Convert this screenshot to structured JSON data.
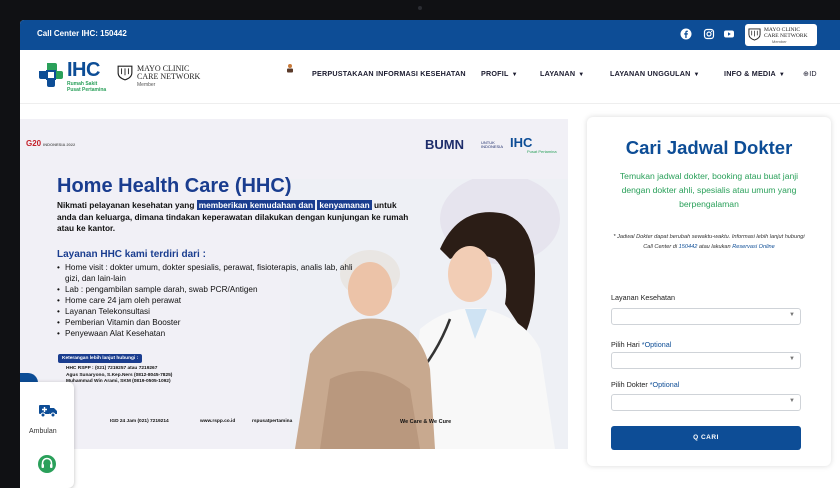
{
  "topbar": {
    "call_center": "Call Center IHC: 150442",
    "social_icons": [
      "facebook-icon",
      "instagram-icon",
      "youtube-icon"
    ],
    "mayo_badge": {
      "line1": "MAYO CLINIC",
      "line2": "CARE NETWORK",
      "line3": "Member"
    }
  },
  "nav": {
    "logo_brand": "IHC",
    "logo_sub1": "Rumah Sakit",
    "logo_sub2": "Pusat Pertamina",
    "mayo_line1": "MAYO CLINIC",
    "mayo_line2": "CARE NETWORK",
    "mayo_member": "Member",
    "items": [
      {
        "label": "PERPUSTAKAAN INFORMASI KESEHATAN",
        "caret": ""
      },
      {
        "label": "PROFIL",
        "caret": "▼"
      },
      {
        "label": "LAYANAN",
        "caret": "▼"
      },
      {
        "label": "LAYANAN UNGGULAN",
        "caret": "▼"
      },
      {
        "label": "INFO & MEDIA",
        "caret": "▼"
      },
      {
        "label": "⊕ID",
        "caret": ""
      }
    ]
  },
  "banner": {
    "g20": "G20",
    "g20_sub": "INDONESIA 2022",
    "bumn": "BUMN",
    "bumn_sub": "UNTUK INDONESIA",
    "ihc": "IHC",
    "ihc_sub": "Pusat Pertamina",
    "title": "Home Health Care (HHC)",
    "lead_1": "Nikmati pelayanan kesehatan yang ",
    "lead_hl1": "memberikan kemudahan dan",
    "lead_hl2": "kenyamanan",
    "lead_2": " untuk anda dan keluarga, dimana tindakan keperawatan dilakukan dengan kunjungan ke rumah atau ke kantor.",
    "layanan_title": "Layanan HHC kami terdiri dari :",
    "layanan": [
      "Home visit : dokter umum, dokter spesialis, perawat, fisioterapis, analis lab, ahli gizi, dan lain-lain",
      "Lab : pengambilan sample darah, swab PCR/Antigen",
      "Home care 24 jam oleh perawat",
      "Layanan Telekonsultasi",
      "Pemberian Vitamin dan Booster",
      "Penyewaan Alat Kesehatan"
    ],
    "ket_title": "Keterangan lebih lanjut hubungi :",
    "ket_lines": [
      "HHC RSPP : (021) 7219257 atau 7219267",
      "Agus Sunaryono, S.Kep.Ners (0812-8045-7825)",
      "Muhammad Win Arami, SKM (0819-0505-1092)"
    ],
    "footer_igd": "IGD 24 Jam (021) 7219214",
    "footer_web": "www.rspp.co.id",
    "footer_social": "rspusatpertamina",
    "footer_tagline": "We Care & We Cure"
  },
  "floating": {
    "ambulance_label": "Ambulan",
    "ambulance_icon": "ambulance-icon",
    "cs_icon": "customer-service-icon"
  },
  "search": {
    "title": "Cari Jadwal Dokter",
    "description": "Temukan jadwal dokter, booking atau buat janji dengan dokter ahli, spesialis atau umum yang berpengalaman",
    "note_1": "* Jadwal Dokter dapat berubah sewaktu-waktu. Informasi lebih lanjut hubungi Call Center di ",
    "note_link1": "150442",
    "note_2": " atau lakukan ",
    "note_link2": "Reservasi Online",
    "label_layanan": "Layanan Kesehatan",
    "label_hari": "Pilih Hari",
    "label_dokter": "Pilih Dokter",
    "optional": "*Optional",
    "button": "Q CARI"
  },
  "colors": {
    "primary": "#0d4d96",
    "accent_green": "#2aa05a",
    "banner_blue": "#1a3d8f"
  }
}
